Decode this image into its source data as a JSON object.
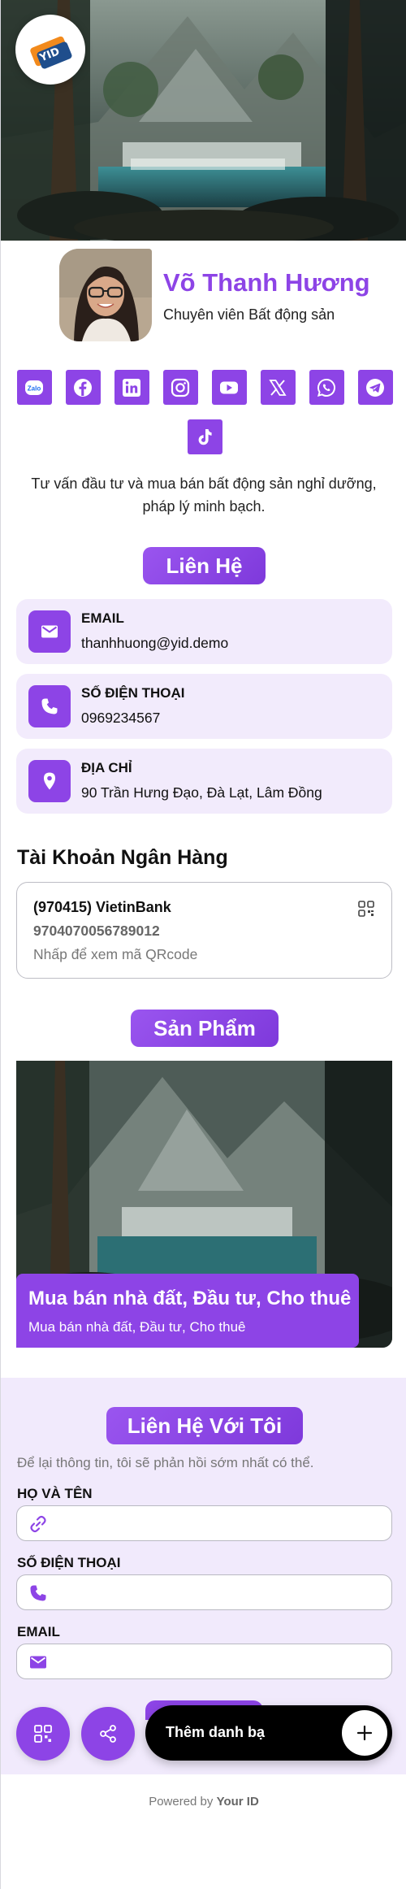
{
  "profile": {
    "name": "Võ Thanh Hương",
    "title": "Chuyên viên Bất động sản",
    "bio": "Tư vấn đầu tư và mua bán bất động sản nghỉ dưỡng, pháp lý minh bạch.",
    "logo_text": "YID"
  },
  "socials": [
    {
      "name": "zalo",
      "label": "Zalo",
      "icon": "zalo-icon"
    },
    {
      "name": "facebook",
      "icon": "facebook-icon"
    },
    {
      "name": "linkedin",
      "icon": "linkedin-icon"
    },
    {
      "name": "instagram",
      "icon": "instagram-icon"
    },
    {
      "name": "youtube",
      "icon": "youtube-icon"
    },
    {
      "name": "x",
      "icon": "x-icon"
    },
    {
      "name": "whatsapp",
      "icon": "whatsapp-icon"
    },
    {
      "name": "telegram",
      "icon": "telegram-icon"
    },
    {
      "name": "tiktok",
      "icon": "tiktok-icon"
    }
  ],
  "contact": {
    "heading": "Liên Hệ",
    "items": [
      {
        "label": "EMAIL",
        "value": "thanhhuong@yid.demo",
        "icon": "mail-icon"
      },
      {
        "label": "SỐ ĐIỆN THOẠI",
        "value": "0969234567",
        "icon": "phone-icon"
      },
      {
        "label": "ĐỊA CHỈ",
        "value": "90 Trần Hưng Đạo, Đà Lạt, Lâm Đồng",
        "icon": "location-icon"
      }
    ]
  },
  "bank": {
    "heading": "Tài Khoản Ngân Hàng",
    "name": "(970415) VietinBank",
    "number": "9704070056789012",
    "hint": "Nhấp để xem mã QRcode",
    "icon": "qr-code-icon"
  },
  "products": {
    "heading": "Sản Phẩm",
    "items": [
      {
        "title": "Mua bán nhà đất, Đầu tư, Cho thuê",
        "subtitle": "Mua bán nhà đất, Đầu tư, Cho thuê"
      }
    ]
  },
  "form": {
    "heading": "Liên Hệ Với Tôi",
    "intro": "Để lại thông tin, tôi sẽ phản hồi sớm nhất có thể.",
    "fields": [
      {
        "label": "HỌ VÀ TÊN",
        "value": "",
        "icon": "link-icon"
      },
      {
        "label": "SỐ ĐIỆN THOẠI",
        "value": "",
        "icon": "phone-icon"
      },
      {
        "label": "EMAIL",
        "value": "",
        "icon": "mail-icon"
      }
    ]
  },
  "actions": {
    "save_label": "Thêm danh bạ",
    "qr_icon": "qr-code-icon",
    "share_icon": "share-icon",
    "add_icon": "plus-icon"
  },
  "footer": {
    "prefix": "Powered by",
    "brand": "Your ID"
  },
  "colors": {
    "accent": "#8d44e6",
    "card_bg": "#f2ebfc",
    "form_bg": "#f1eafc",
    "save_bar": "#000000"
  }
}
